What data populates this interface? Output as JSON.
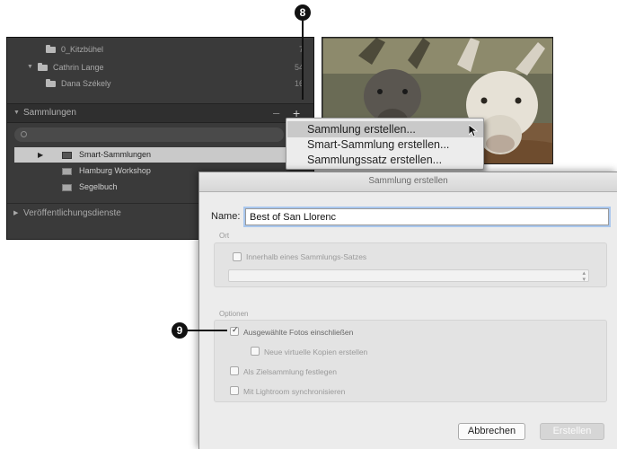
{
  "callouts": {
    "menu": "8",
    "option": "9"
  },
  "folders": [
    {
      "name": "0_Kitzbühel",
      "count": "7"
    },
    {
      "name": "Cathrin Lange",
      "count": "54"
    },
    {
      "name": "Dana Székely",
      "count": "16"
    }
  ],
  "panel": {
    "collections_header": "Sammlungen",
    "minus": "–",
    "plus": "+",
    "collections": [
      {
        "name": "Smart-Sammlungen",
        "selected": true
      },
      {
        "name": "Hamburg Workshop",
        "selected": false
      },
      {
        "name": "Segelbuch",
        "selected": false
      }
    ],
    "publish_header": "Veröffentlichungsdienste"
  },
  "context_menu": {
    "items": [
      {
        "label": "Sammlung erstellen...",
        "highlighted": true
      },
      {
        "label": "Smart-Sammlung erstellen...",
        "highlighted": false
      },
      {
        "label": "Sammlungssatz erstellen...",
        "highlighted": false
      }
    ]
  },
  "dialog": {
    "title": "Sammlung erstellen",
    "name_label": "Name:",
    "name_value": "Best of San Llorenc",
    "location_group": "Ort",
    "inside_set_label": "Innerhalb eines Sammlungs-Satzes",
    "options_group": "Optionen",
    "options": [
      {
        "label": "Ausgewählte Fotos einschließen",
        "checked": true
      },
      {
        "label": "Neue virtuelle Kopien erstellen",
        "checked": false
      },
      {
        "label": "Als Zielsammlung festlegen",
        "checked": false
      },
      {
        "label": "Mit Lightroom synchronisieren",
        "checked": false
      }
    ],
    "cancel_label": "Abbrechen",
    "create_label": "Erstellen"
  },
  "colors": {
    "panel_bg": "#3a3a3a",
    "menu_highlight": "#c9c9c9",
    "dialog_bg": "#ececec"
  }
}
